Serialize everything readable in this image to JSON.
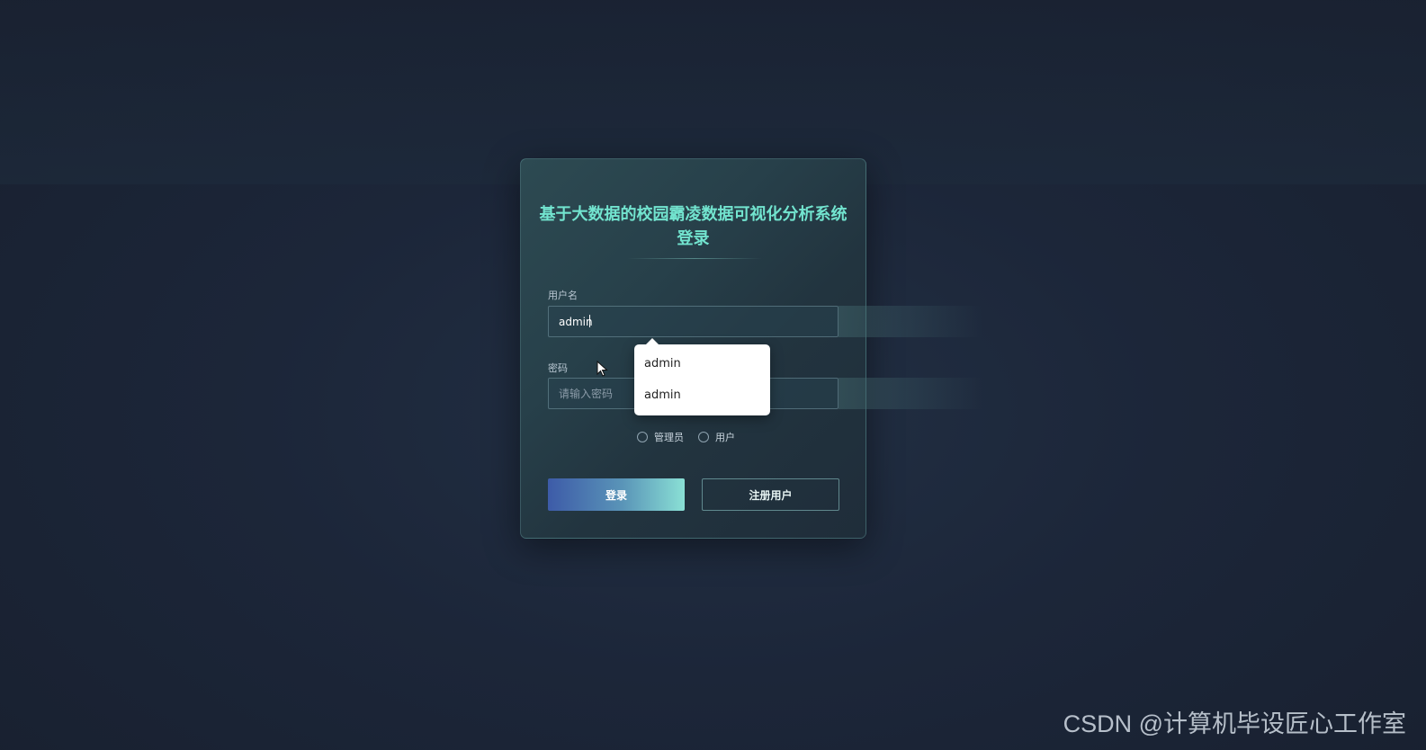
{
  "login": {
    "title": "基于大数据的校园霸凌数据可视化分析系统登录",
    "username_label": "用户名",
    "username_value": "admin",
    "password_label": "密码",
    "password_placeholder": "请输入密码",
    "roles": [
      "管理员",
      "用户"
    ],
    "login_button": "登录",
    "register_button": "注册用户"
  },
  "autocomplete": {
    "items": [
      "admin",
      "admin"
    ]
  },
  "watermark": "CSDN @计算机毕设匠心工作室"
}
